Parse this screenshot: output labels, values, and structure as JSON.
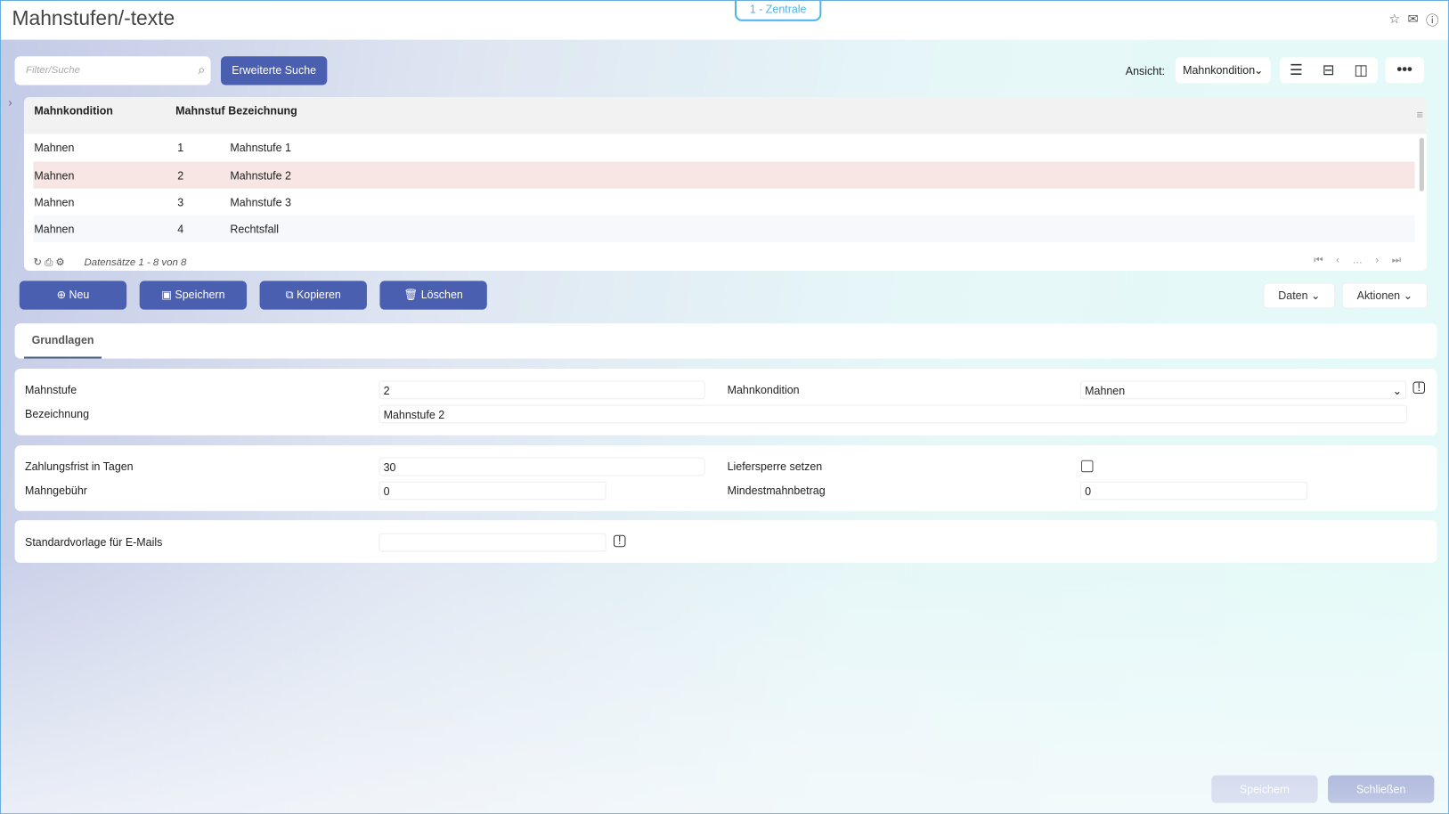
{
  "header": {
    "title": "Mahnstufen/-texte",
    "context": "1 - Zentrale"
  },
  "search": {
    "placeholder": "Filter/Suche",
    "advanced_label": "Erweiterte Suche"
  },
  "view": {
    "label": "Ansicht:",
    "selected": "Mahnkondition"
  },
  "table": {
    "columns": [
      "Mahnkondition",
      "Mahnstuf",
      "Bezeichnung"
    ],
    "rows": [
      {
        "kondition": "Mahnen",
        "stufe": "1",
        "bezeichnung": "Mahnstufe 1"
      },
      {
        "kondition": "Mahnen",
        "stufe": "2",
        "bezeichnung": "Mahnstufe 2"
      },
      {
        "kondition": "Mahnen",
        "stufe": "3",
        "bezeichnung": "Mahnstufe 3"
      },
      {
        "kondition": "Mahnen",
        "stufe": "4",
        "bezeichnung": "Rechtsfall"
      }
    ],
    "record_info": "Datensätze 1 - 8 von 8"
  },
  "toolbar": {
    "new": "Neu",
    "save": "Speichern",
    "copy": "Kopieren",
    "delete": "Löschen",
    "data": "Daten",
    "actions": "Aktionen"
  },
  "tabs": [
    "Grundlagen"
  ],
  "form": {
    "mahnstufe_label": "Mahnstufe",
    "mahnstufe": "2",
    "mahnkondition_label": "Mahnkondition",
    "mahnkondition": "Mahnen",
    "bezeichnung_label": "Bezeichnung",
    "bezeichnung": "Mahnstufe 2",
    "zahlungsfrist_label": "Zahlungsfrist in Tagen",
    "zahlungsfrist": "30",
    "liefersperre_label": "Liefersperre setzen",
    "mahngebuehr_label": "Mahngebühr",
    "mahngebuehr": "0",
    "mindest_label": "Mindestmahnbetrag",
    "mindest": "0",
    "vorlage_label": "Standardvorlage für E-Mails",
    "vorlage": ""
  },
  "footer": {
    "save": "Speichern",
    "close": "Schließen"
  }
}
